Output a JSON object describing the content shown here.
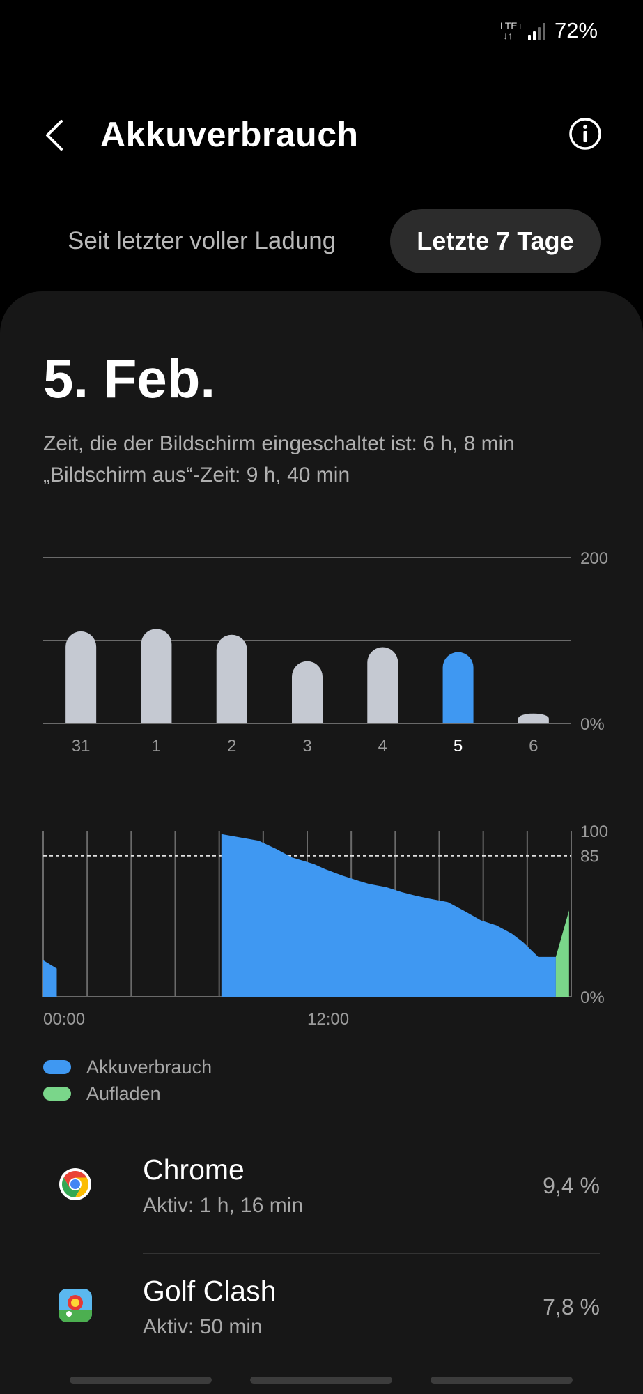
{
  "status_bar": {
    "network": "LTE+",
    "arrows": "↓↑",
    "battery": "72%"
  },
  "header": {
    "title": "Akkuverbrauch"
  },
  "tabs": [
    {
      "label": "Seit letzter voller Ladung",
      "selected": false
    },
    {
      "label": "Letzte 7 Tage",
      "selected": true
    }
  ],
  "summary": {
    "date": "5. Feb.",
    "screen_on": "Zeit, die der Bildschirm eingeschaltet ist: 6 h, 8 min",
    "screen_off": "„Bildschirm aus“-Zeit: 9 h, 40 min"
  },
  "colors": {
    "accent_blue": "#3f98f2",
    "charging_green": "#7ad68a",
    "bar_gray": "#c5c9d2",
    "card_bg": "#171717"
  },
  "chart_data": [
    {
      "type": "bar",
      "categories": [
        "31",
        "1",
        "2",
        "3",
        "4",
        "5",
        "6"
      ],
      "values": [
        111,
        114,
        107,
        75,
        92,
        86,
        12
      ],
      "selected_category": "5",
      "y_tick_labels": [
        "0%",
        "200"
      ],
      "ylim": [
        0,
        200
      ],
      "grid": true
    },
    {
      "type": "area",
      "x_tick_labels": [
        "00:00",
        "12:00"
      ],
      "y_tick_labels": [
        "0%",
        "85",
        "100"
      ],
      "ylim": [
        0,
        100
      ],
      "threshold_line": 85,
      "x_unit": "hours",
      "xlim": [
        0,
        24
      ],
      "series": [
        {
          "name": "Akkuverbrauch",
          "x": [
            0,
            0.3,
            8.1,
            8.1,
            9.8,
            10.6,
            11.3,
            12.3,
            12.8,
            13.6,
            14.3,
            14.8,
            15.6,
            16.3,
            16.9,
            17.6,
            18.4,
            19.1,
            19.9,
            20.6,
            21.3,
            21.8,
            22.5,
            23.3
          ],
          "y": [
            22,
            17,
            0,
            98,
            94,
            89,
            84,
            80,
            77,
            73,
            70,
            68,
            66,
            63,
            61,
            59,
            57,
            52,
            46,
            43,
            38,
            33,
            24,
            24
          ]
        },
        {
          "name": "Aufladen",
          "x": [
            23.3,
            23.9
          ],
          "y": [
            24,
            52
          ]
        }
      ],
      "legend_position": "bottom-left"
    }
  ],
  "legend": [
    {
      "label": "Akkuverbrauch",
      "color": "#3f98f2"
    },
    {
      "label": "Aufladen",
      "color": "#7ad68a"
    }
  ],
  "apps": [
    {
      "name": "Chrome",
      "active": "Aktiv: 1 h, 16 min",
      "percent": "9,4 %",
      "icon": "chrome-icon"
    },
    {
      "name": "Golf Clash",
      "active": "Aktiv: 50 min",
      "percent": "7,8 %",
      "icon": "golf-clash-icon"
    }
  ]
}
